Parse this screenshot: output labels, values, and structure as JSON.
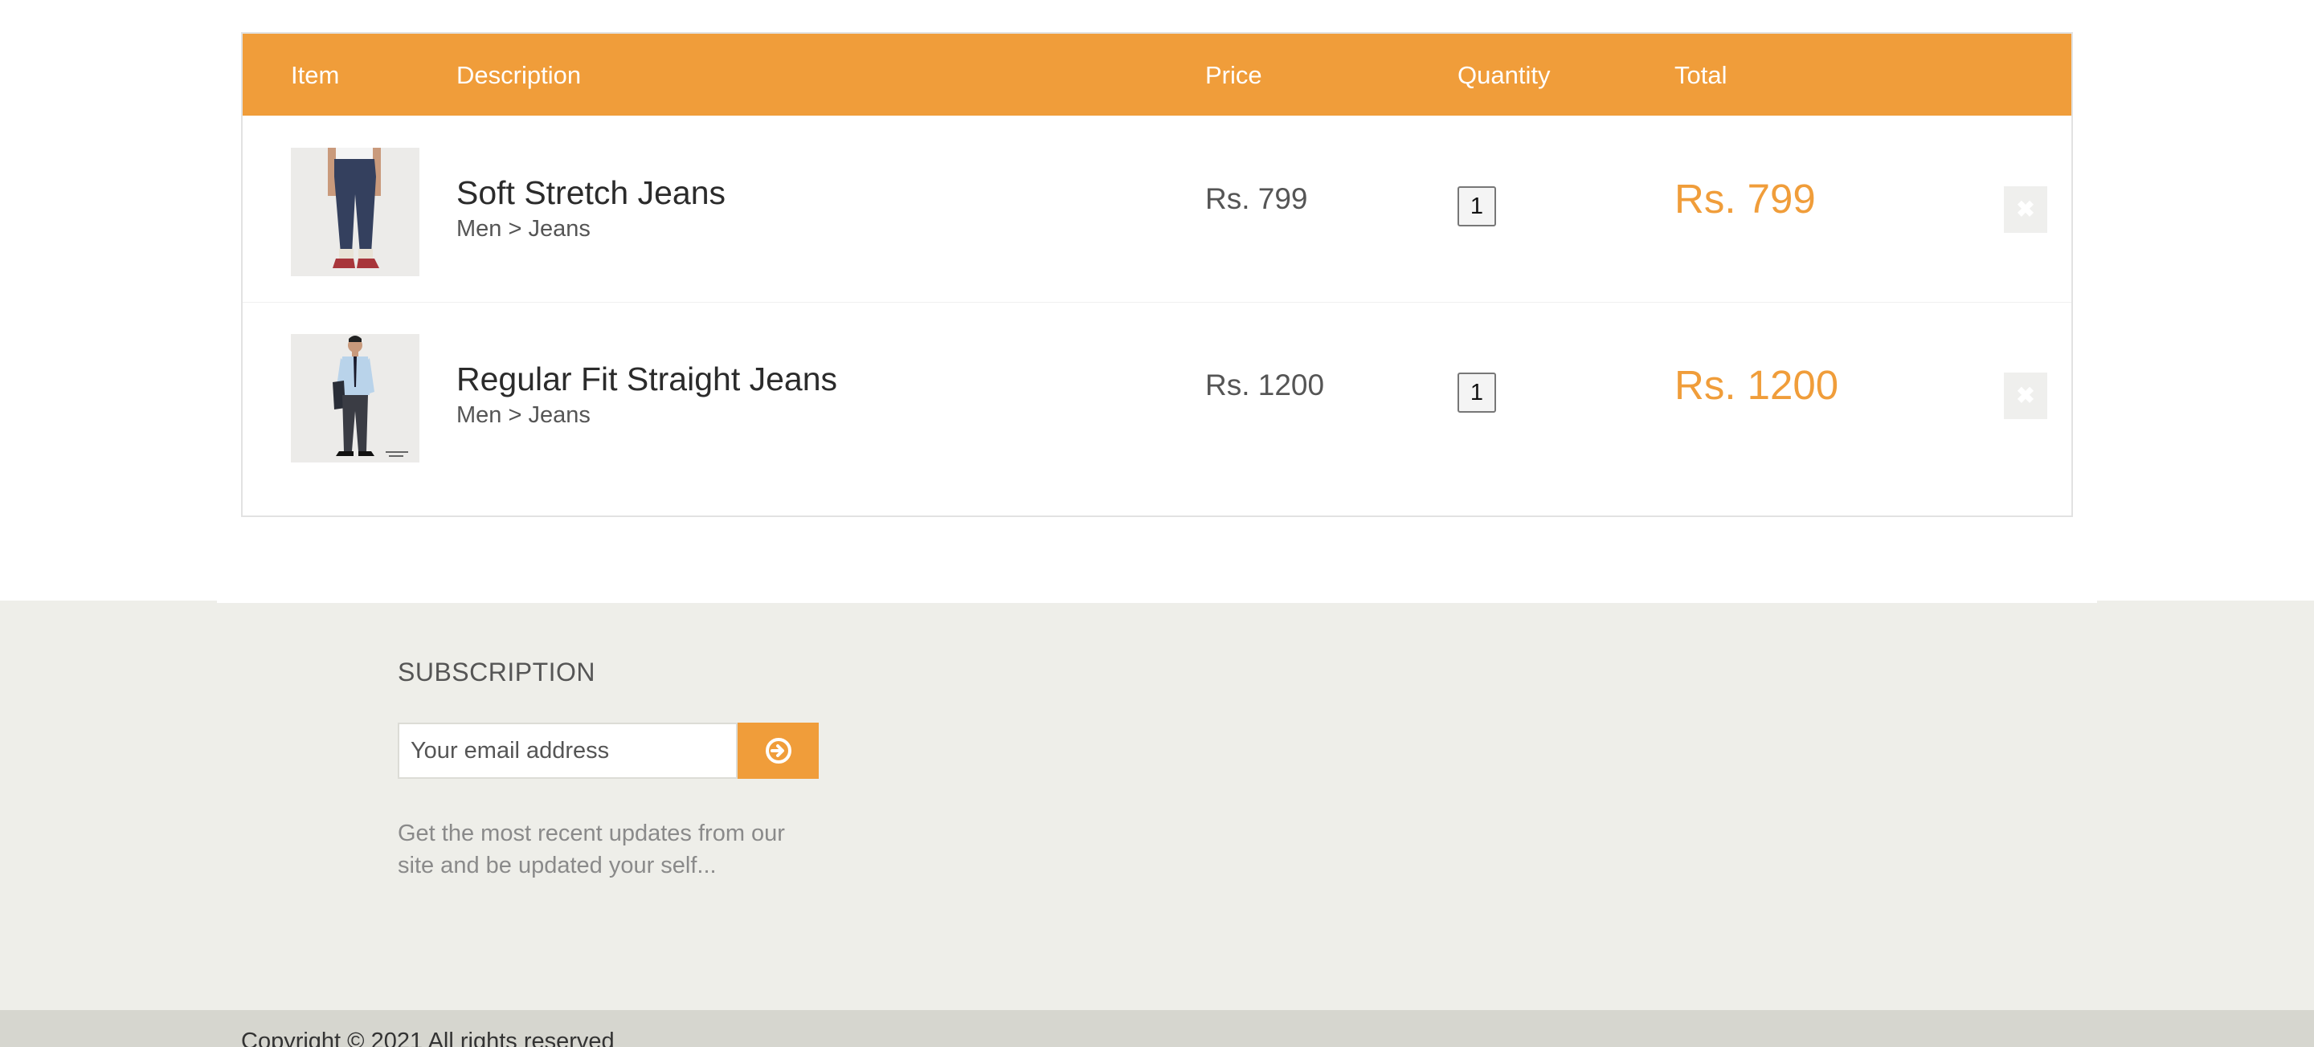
{
  "cart": {
    "headers": {
      "item": "Item",
      "description": "Description",
      "price": "Price",
      "quantity": "Quantity",
      "total": "Total"
    },
    "items": [
      {
        "name": "Soft Stretch Jeans",
        "category": "Men > Jeans",
        "price": "Rs. 799",
        "quantity": "1",
        "total": "Rs. 799",
        "remove_icon": "close-icon"
      },
      {
        "name": "Regular Fit Straight Jeans",
        "category": "Men > Jeans",
        "price": "Rs. 1200",
        "quantity": "1",
        "total": "Rs. 1200",
        "remove_icon": "close-icon"
      }
    ]
  },
  "subscription": {
    "title": "SUBSCRIPTION",
    "email_placeholder": "Your email address",
    "submit_icon": "arrow-circle-right-icon",
    "description": "Get the most recent updates from our site and be updated your self..."
  },
  "footer": {
    "copyright": "Copyright © 2021 All rights reserved"
  },
  "colors": {
    "accent": "#f09d3a",
    "subscription_bg": "#eeeee9",
    "footer_bg": "#d6d6cf"
  }
}
